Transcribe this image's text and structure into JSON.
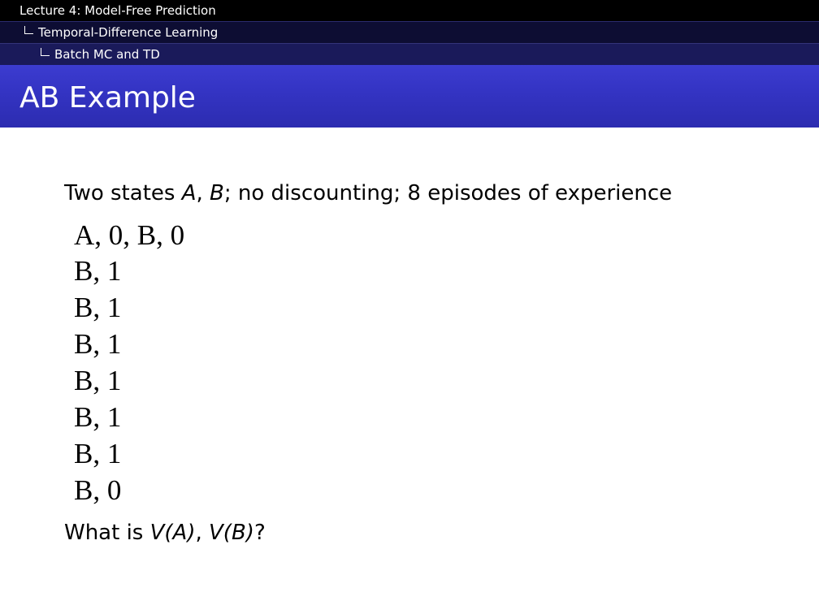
{
  "breadcrumb": {
    "lecture": "Lecture 4: Model-Free Prediction",
    "section": "Temporal-Difference Learning",
    "subsection": "Batch MC and TD"
  },
  "slide": {
    "title": "AB Example",
    "intro_prefix": "Two states ",
    "intro_state_a": "A",
    "intro_comma": ", ",
    "intro_state_b": "B",
    "intro_suffix": "; no discounting; 8 episodes of experience",
    "episodes": [
      "A, 0, B, 0",
      "B, 1",
      "B, 1",
      "B, 1",
      "B, 1",
      "B, 1",
      "B, 1",
      "B, 0"
    ],
    "question_prefix": "What is ",
    "question_va": "V(A)",
    "question_sep": ", ",
    "question_vb": "V(B)",
    "question_suffix": "?"
  },
  "colors": {
    "nav_background": "#000000",
    "title_bar": "#3434c4",
    "title_text": "#ffffff"
  }
}
